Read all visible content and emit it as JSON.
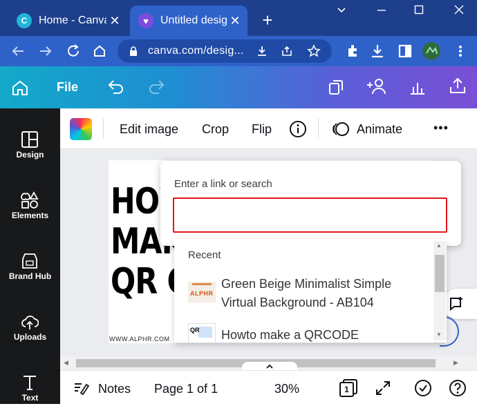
{
  "browser": {
    "tabs": [
      {
        "title": "Home - Canva",
        "active": false
      },
      {
        "title": "Untitled design",
        "active": true
      }
    ],
    "new_tab_label": "+",
    "url": "canva.com/desig...",
    "window_controls": [
      "minimize-icon",
      "maximize-icon",
      "close-icon"
    ]
  },
  "canva_toolbar": {
    "file_label": "File",
    "icons": [
      "home-icon",
      "undo-icon",
      "redo-icon",
      "resize-icon",
      "share-people-icon",
      "insights-icon",
      "upload-icon"
    ]
  },
  "rail": {
    "items": [
      {
        "label": "Design",
        "icon": "layout-icon"
      },
      {
        "label": "Elements",
        "icon": "shapes-icon"
      },
      {
        "label": "Brand Hub",
        "icon": "brand-icon"
      },
      {
        "label": "Uploads",
        "icon": "cloud-upload-icon"
      },
      {
        "label": "Text",
        "icon": "text-icon"
      }
    ]
  },
  "context_toolbar": {
    "edit_image": "Edit image",
    "crop": "Crop",
    "flip": "Flip",
    "animate": "Animate",
    "more": "•••"
  },
  "design": {
    "lines": [
      "HOW TO",
      "MAKE A",
      "QR CODE"
    ],
    "footer_url": "WWW.ALPHR.COM"
  },
  "link_popover": {
    "title": "Enter a link or search",
    "input_value": "",
    "recent_label": "Recent",
    "recent_items": [
      {
        "title": "Green Beige Minimalist Simple Virtual Background - AB104",
        "thumb_text": "ALPHR"
      },
      {
        "title": "Howto make a QRCODE",
        "thumb_text": "QR"
      }
    ]
  },
  "bottom_bar": {
    "notes": "Notes",
    "page": "Page 1 of 1",
    "zoom": "30%",
    "pages_count": "1"
  },
  "colors": {
    "tabstrip": "#1d3f8c",
    "address_bar": "#2f62c9",
    "rail": "#18191b",
    "input_border": "#e0151a"
  }
}
